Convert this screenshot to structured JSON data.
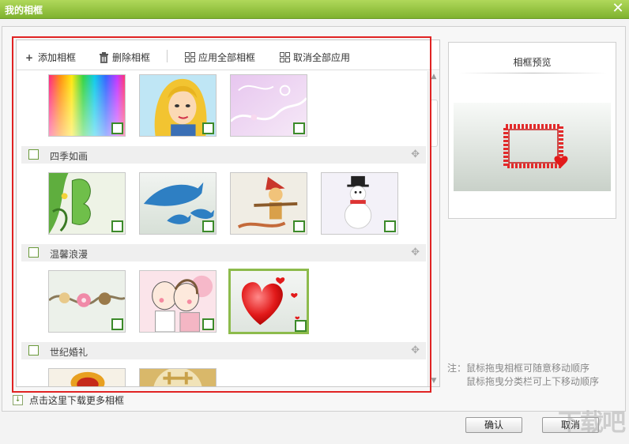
{
  "window": {
    "title": "我的相框",
    "close_symbol": "✕"
  },
  "toolbar": {
    "add_label": "添加相框",
    "delete_label": "删除相框",
    "apply_all_label": "应用全部相框",
    "cancel_all_label": "取消全部应用"
  },
  "categories": [
    {
      "name": "四季如画"
    },
    {
      "name": "温馨浪漫"
    },
    {
      "name": "世纪婚礼"
    }
  ],
  "download_label": "点击这里下载更多相框",
  "preview": {
    "title": "相框预览"
  },
  "note": {
    "line1": "注：鼠标拖曳相框可随意移动顺序",
    "line2": "鼠标拖曳分类栏可上下移动顺序"
  },
  "buttons": {
    "ok": "确认",
    "cancel": "取消"
  },
  "watermark": "下载吧",
  "colors": {
    "title_bar": "#8dc03b",
    "highlight_outline": "#e02323",
    "checkbox_green": "#3c8a2a",
    "selected_border": "#8dbb4c"
  }
}
